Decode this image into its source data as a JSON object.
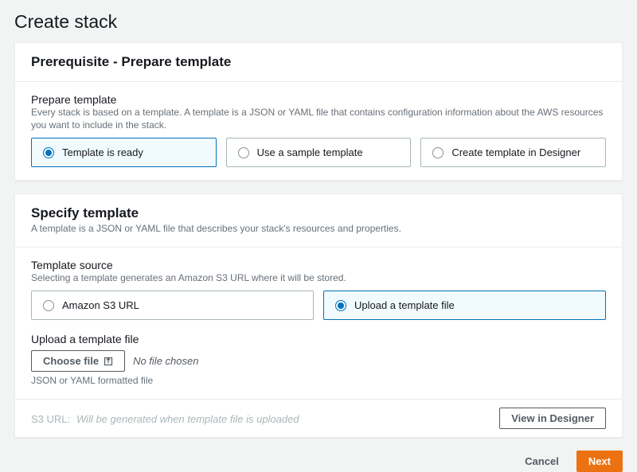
{
  "page": {
    "title": "Create stack"
  },
  "prereq": {
    "heading": "Prerequisite - Prepare template",
    "field_label": "Prepare template",
    "field_help": "Every stack is based on a template. A template is a JSON or YAML file that contains configuration information about the AWS resources you want to include in the stack.",
    "options": {
      "ready": "Template is ready",
      "sample": "Use a sample template",
      "designer": "Create template in Designer"
    }
  },
  "specify": {
    "heading": "Specify template",
    "subtitle": "A template is a JSON or YAML file that describes your stack's resources and properties.",
    "source_label": "Template source",
    "source_help": "Selecting a template generates an Amazon S3 URL where it will be stored.",
    "options": {
      "s3": "Amazon S3 URL",
      "upload": "Upload a template file"
    },
    "upload_label": "Upload a template file",
    "choose_file": "Choose file",
    "no_file": "No file chosen",
    "upload_help": "JSON or YAML formatted file",
    "s3_url_label": "S3 URL:",
    "s3_url_value": "Will be generated when template file is uploaded",
    "view_in_designer": "View in Designer"
  },
  "actions": {
    "cancel": "Cancel",
    "next": "Next"
  }
}
